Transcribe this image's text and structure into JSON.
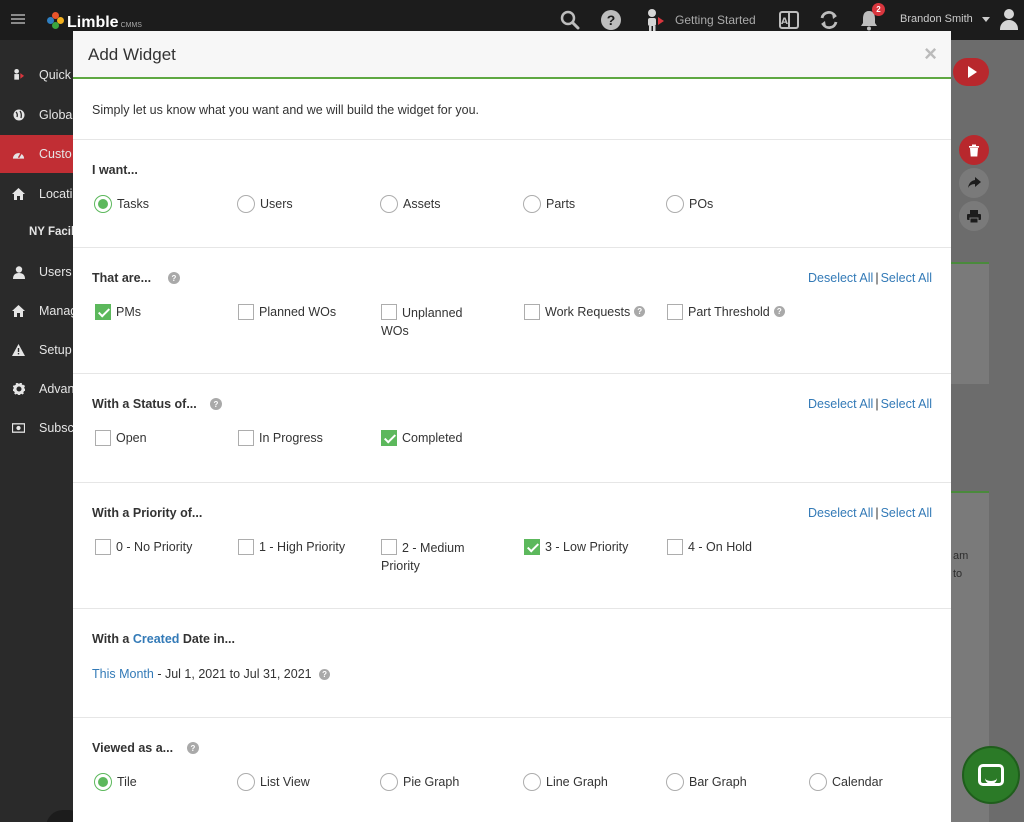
{
  "topbar": {
    "logo_text": "Limble",
    "logo_sub": "CMMS",
    "getting_started": "Getting Started",
    "notification_count": "2",
    "user_name": "Brandon Smith"
  },
  "sidenav": {
    "items": [
      {
        "label": "Quick"
      },
      {
        "label": "Globa"
      },
      {
        "label": "Custo"
      },
      {
        "label": "Locati"
      },
      {
        "label": "NY Facil"
      },
      {
        "label": "Users"
      },
      {
        "label": "Manag"
      },
      {
        "label": "Setup"
      },
      {
        "label": "Advan"
      },
      {
        "label": "Subsc"
      }
    ]
  },
  "background": {
    "text_line1": "am",
    "text_line2": "to"
  },
  "modal": {
    "title": "Add Widget",
    "close": "×",
    "intro": "Simply let us know what you want and we will build the widget for you.",
    "i_want": {
      "title": "I want...",
      "options": [
        {
          "label": "Tasks",
          "selected": true
        },
        {
          "label": "Users",
          "selected": false
        },
        {
          "label": "Assets",
          "selected": false
        },
        {
          "label": "Parts",
          "selected": false
        },
        {
          "label": "POs",
          "selected": false
        }
      ]
    },
    "that_are": {
      "title": "That are...",
      "deselect_all": "Deselect All",
      "sep": "|",
      "select_all": "Select All",
      "options": [
        {
          "label": "PMs",
          "checked": true
        },
        {
          "label": "Planned WOs",
          "checked": false
        },
        {
          "label": "Unplanned WOs",
          "checked": false
        },
        {
          "label": "Work Requests",
          "checked": false
        },
        {
          "label": "Part Threshold",
          "checked": false
        }
      ]
    },
    "status": {
      "title": "With a Status of...",
      "deselect_all": "Deselect All",
      "sep": "|",
      "select_all": "Select All",
      "options": [
        {
          "label": "Open",
          "checked": false
        },
        {
          "label": "In Progress",
          "checked": false
        },
        {
          "label": "Completed",
          "checked": true
        }
      ]
    },
    "priority": {
      "title": "With a Priority of...",
      "deselect_all": "Deselect All",
      "sep": "|",
      "select_all": "Select All",
      "options": [
        {
          "label": "0 - No Priority",
          "checked": false
        },
        {
          "label": "1 - High Priority",
          "checked": false
        },
        {
          "label": "2 - Medium Priority",
          "checked": false
        },
        {
          "label": "3 - Low Priority",
          "checked": true
        },
        {
          "label": "4 - On Hold",
          "checked": false
        }
      ]
    },
    "created_date": {
      "title_prefix": "With a",
      "title_link": "Created",
      "title_suffix": "Date in...",
      "range_link": "This Month",
      "range_text": "- Jul 1, 2021 to Jul 31, 2021"
    },
    "viewed_as": {
      "title": "Viewed as a...",
      "options": [
        {
          "label": "Tile",
          "selected": true
        },
        {
          "label": "List View",
          "selected": false
        },
        {
          "label": "Pie Graph",
          "selected": false
        },
        {
          "label": "Line Graph",
          "selected": false
        },
        {
          "label": "Bar Graph",
          "selected": false
        },
        {
          "label": "Calendar",
          "selected": false
        }
      ]
    }
  },
  "colors": {
    "accent_green": "#5cb85c",
    "header_rule": "#5fa842",
    "link_blue": "#337ab7",
    "nav_active": "#c12e34",
    "topbar": "#1c1c1c"
  }
}
